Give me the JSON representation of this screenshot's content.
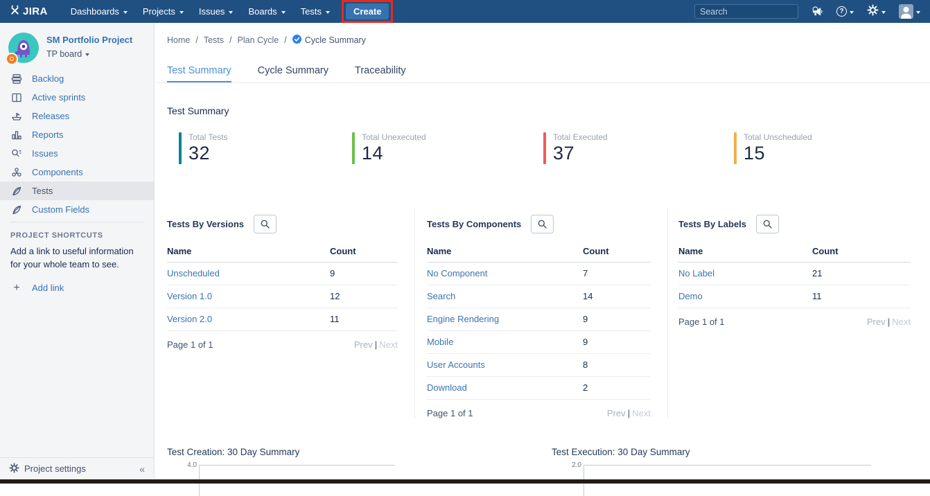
{
  "navbar": {
    "logo_text": "JIRA",
    "menus": [
      {
        "label": "Dashboards"
      },
      {
        "label": "Projects"
      },
      {
        "label": "Issues"
      },
      {
        "label": "Boards"
      },
      {
        "label": "Tests"
      }
    ],
    "create_label": "Create",
    "search_placeholder": "Search",
    "icon_names": [
      "jira-logo-icon",
      "search-icon",
      "megaphone-icon",
      "help-icon",
      "settings-gear-icon",
      "user-avatar-icon",
      "dropdown-caret"
    ]
  },
  "annotation": {
    "shape": "highlight-box",
    "target": "Create button",
    "color": "#e8291c"
  },
  "sidebar": {
    "project_name": "SM Portfolio Project",
    "board_name": "TP board",
    "items": [
      {
        "label": "Backlog",
        "icon": "backlog-icon",
        "selected": false
      },
      {
        "label": "Active sprints",
        "icon": "active-sprints-icon",
        "selected": false
      },
      {
        "label": "Releases",
        "icon": "releases-icon",
        "selected": false
      },
      {
        "label": "Reports",
        "icon": "reports-icon",
        "selected": false
      },
      {
        "label": "Issues",
        "icon": "issues-icon",
        "selected": false
      },
      {
        "label": "Components",
        "icon": "components-icon",
        "selected": false
      },
      {
        "label": "Tests",
        "icon": "tests-icon",
        "selected": true
      },
      {
        "label": "Custom Fields",
        "icon": "custom-fields-icon",
        "selected": false
      }
    ],
    "shortcuts_title": "PROJECT SHORTCUTS",
    "shortcuts_text": "Add a link to useful information for your whole team to see.",
    "add_link_label": "Add link",
    "project_settings_label": "Project settings",
    "collapse_glyph": "«"
  },
  "breadcrumb": {
    "items": [
      "Home",
      "Tests",
      "Plan Cycle",
      "Cycle Summary"
    ],
    "separator": "/"
  },
  "tabs": [
    {
      "label": "Test Summary",
      "active": true
    },
    {
      "label": "Cycle Summary",
      "active": false
    },
    {
      "label": "Traceability",
      "active": false
    }
  ],
  "main": {
    "heading": "Test Summary",
    "stats": [
      {
        "label": "Total Tests",
        "value": "32",
        "color": "#00848f"
      },
      {
        "label": "Total Unexecuted",
        "value": "14",
        "color": "#6cc04a"
      },
      {
        "label": "Total Executed",
        "value": "37",
        "color": "#ef5b5b"
      },
      {
        "label": "Total Unscheduled",
        "value": "15",
        "color": "#f0b04d"
      }
    ],
    "tables": [
      {
        "title": "Tests By Versions",
        "columns": [
          "Name",
          "Count"
        ],
        "rows": [
          [
            "Unscheduled",
            "9"
          ],
          [
            "Version 1.0",
            "12"
          ],
          [
            "Version 2.0",
            "11"
          ]
        ],
        "page_label": "Page 1 of 1",
        "prev_label": "Prev",
        "pager_separator": "|",
        "next_label": "Next"
      },
      {
        "title": "Tests By Components",
        "columns": [
          "Name",
          "Count"
        ],
        "rows": [
          [
            "No Component",
            "7"
          ],
          [
            "Search",
            "14"
          ],
          [
            "Engine Rendering",
            "9"
          ],
          [
            "Mobile",
            "9"
          ],
          [
            "User Accounts",
            "8"
          ],
          [
            "Download",
            "2"
          ]
        ],
        "page_label": "Page 1 of 1",
        "prev_label": "Prev",
        "pager_separator": "|",
        "next_label": "Next"
      },
      {
        "title": "Tests By Labels",
        "columns": [
          "Name",
          "Count"
        ],
        "rows": [
          [
            "No Label",
            "21"
          ],
          [
            "Demo",
            "11"
          ]
        ],
        "page_label": "Page 1 of 1",
        "prev_label": "Prev",
        "pager_separator": "|",
        "next_label": "Next"
      }
    ],
    "charts": [
      {
        "title": "Test Creation: 30 Day Summary",
        "y_axis_top_label": "4.0"
      },
      {
        "title": "Test Execution: 30 Day Summary",
        "y_axis_top_label": "2.0"
      }
    ]
  }
}
